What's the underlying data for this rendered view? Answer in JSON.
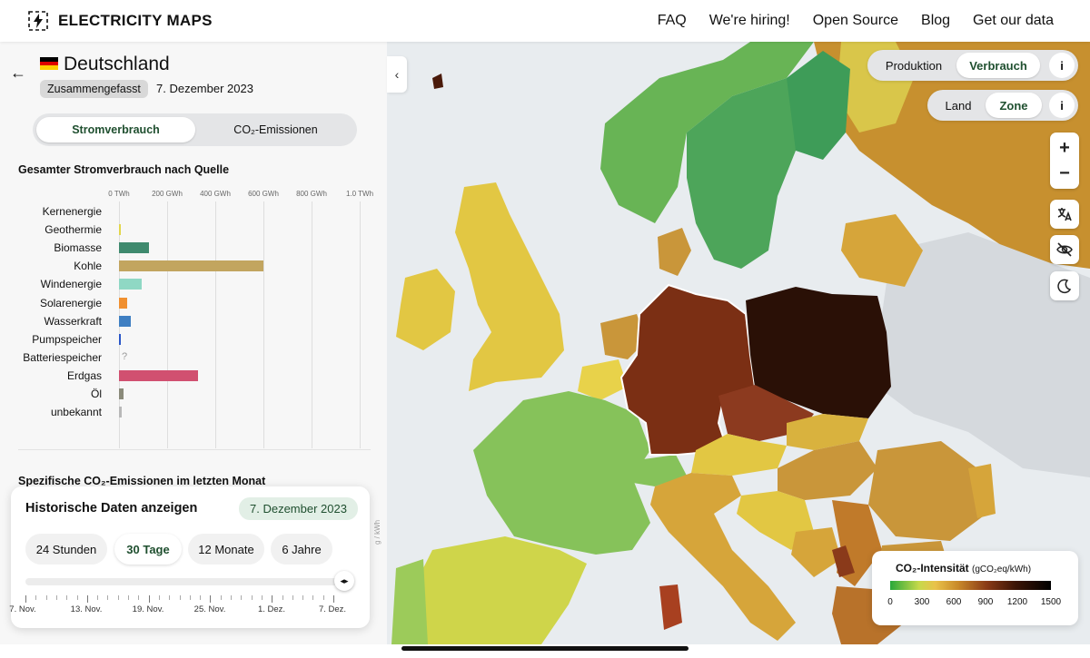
{
  "app": {
    "name": "ELECTRICITY MAPS",
    "nav": [
      "FAQ",
      "We're hiring!",
      "Open Source",
      "Blog",
      "Get our data"
    ]
  },
  "panel": {
    "country": "Deutschland",
    "badge": "Zusammengefasst",
    "date": "7. Dezember 2023",
    "tabs": [
      "Stromverbrauch",
      "CO₂-Emissionen"
    ],
    "active_tab": "Stromverbrauch",
    "section1_title": "Gesamter Stromverbrauch nach Quelle",
    "section2_title": "Spezifische CO₂-Emissionen im letzten Monat",
    "unit_label": "g / kWh",
    "unknown_marker": "?"
  },
  "chart_data": {
    "type": "bar",
    "orientation": "horizontal",
    "title": "Gesamter Stromverbrauch nach Quelle",
    "x_ticks": [
      "0 TWh",
      "200 GWh",
      "400 GWh",
      "600 GWh",
      "800 GWh",
      "1.0 TWh"
    ],
    "xlim_gwh": [
      0,
      1000
    ],
    "categories": [
      "Kernenergie",
      "Geothermie",
      "Biomasse",
      "Kohle",
      "Windenergie",
      "Solarenergie",
      "Wasserkraft",
      "Pumpspeicher",
      "Batteriespeicher",
      "Erdgas",
      "Öl",
      "unbekannt"
    ],
    "values_gwh": [
      0,
      2,
      125,
      600,
      95,
      35,
      48,
      7,
      null,
      330,
      18,
      10
    ],
    "colors": [
      "#9b6fb5",
      "#e2d64a",
      "#3f8a6e",
      "#c2a55f",
      "#8fd8c4",
      "#f09030",
      "#3f7fc2",
      "#2a56c8",
      "#999999",
      "#d15070",
      "#8a8a7a",
      "#b8b8b8"
    ],
    "grid": true
  },
  "history": {
    "title": "Historische Daten anzeigen",
    "date": "7. Dezember 2023",
    "ranges": [
      "24 Stunden",
      "30 Tage",
      "12 Monate",
      "6 Jahre"
    ],
    "active_range": "30 Tage",
    "tick_dates": [
      "7. Nov.",
      "13. Nov.",
      "19. Nov.",
      "25. Nov.",
      "1. Dez.",
      "7. Dez."
    ],
    "slider_position": 1.0,
    "handle_glyph": "◂▸"
  },
  "map_controls": {
    "mode": [
      "Produktion",
      "Verbrauch"
    ],
    "active_mode": "Verbrauch",
    "scope": [
      "Land",
      "Zone"
    ],
    "active_scope": "Zone",
    "info": "i",
    "zoom_in": "+",
    "zoom_out": "−"
  },
  "legend": {
    "title": "CO₂-Intensität",
    "unit": "(gCO₂eq/kWh)",
    "labels": [
      "0",
      "300",
      "600",
      "900",
      "1200",
      "1500"
    ]
  },
  "colors": {
    "accent_green": "#1f4f2f",
    "germany": "#7b2f14",
    "poland": "#2a1006",
    "czech": "#8c3a1f",
    "france": "#86c25a",
    "scandinavia": "#56a85a"
  }
}
